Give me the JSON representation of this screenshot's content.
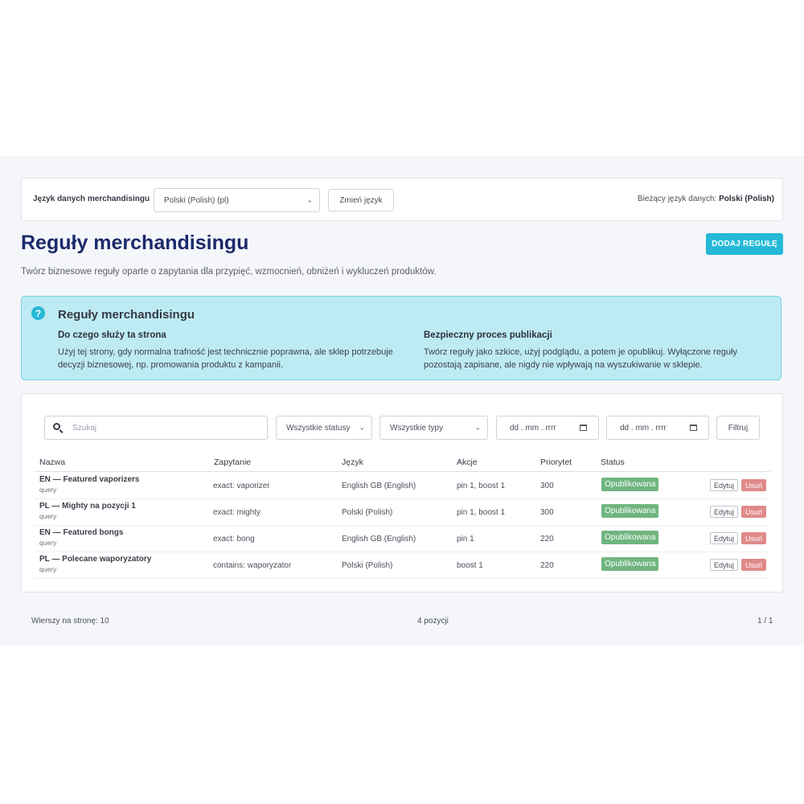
{
  "language_bar": {
    "label": "Język danych merchandisingu",
    "selected_language": "Polski (Polish) (pl)",
    "change_button": "Zmień język",
    "current_prefix": "Bieżący język danych:",
    "current_value": "Polski (Polish)"
  },
  "page": {
    "title": "Reguły merchandisingu",
    "add_button": "DODAJ REGUŁĘ",
    "subtitle": "Twórz biznesowe reguły oparte o zapytania dla przypięć, wzmocnień, obniżeń i wykluczeń produktów."
  },
  "info": {
    "title": "Reguły merchandisingu",
    "col1_heading": "Do czego służy ta strona",
    "col1_text": "Użyj tej strony, gdy normalna trafność jest technicznie poprawna, ale sklep potrzebuje decyzji biznesowej, np. promowania produktu z kampanii.",
    "col2_heading": "Bezpieczny proces publikacji",
    "col2_text": "Twórz reguły jako szkice, użyj podglądu, a potem je opublikuj. Wyłączone reguły pozostają zapisane, ale nigdy nie wpływają na wyszukiwanie w sklepie."
  },
  "filters": {
    "search_placeholder": "Szukaj",
    "status_select": "Wszystkie statusy",
    "type_select": "Wszystkie typy",
    "date_from_placeholder": "dd . mm . rrrr",
    "date_to_placeholder": "dd . mm . rrrr",
    "filter_button": "Filtruj"
  },
  "table": {
    "headers": [
      "Nazwa",
      "Zapytanie",
      "Język",
      "Akcje",
      "Priorytet",
      "Status"
    ],
    "edit_label": "Edytuj",
    "delete_label": "Usuń",
    "rows": [
      {
        "name": "EN — Featured vaporizers",
        "sub": "query",
        "query": "exact: vaporizer",
        "language": "English GB (English)",
        "actions": "pin 1, boost 1",
        "priority": "300",
        "status": "Opublikowana"
      },
      {
        "name": "PL — Mighty na pozycji 1",
        "sub": "query",
        "query": "exact: mighty",
        "language": "Polski (Polish)",
        "actions": "pin 1, boost 1",
        "priority": "300",
        "status": "Opublikowana"
      },
      {
        "name": "EN — Featured bongs",
        "sub": "query",
        "query": "exact: bong",
        "language": "English GB (English)",
        "actions": "pin 1",
        "priority": "220",
        "status": "Opublikowana"
      },
      {
        "name": "PL — Polecane waporyzatory",
        "sub": "query",
        "query": "contains: waporyzator",
        "language": "Polski (Polish)",
        "actions": "boost 1",
        "priority": "220",
        "status": "Opublikowana"
      }
    ]
  },
  "footer": {
    "rows_per_page": "Wierszy na stronę: 10",
    "count": "4 pozycji",
    "pages": "1 / 1"
  },
  "colors": {
    "accent": "#25b9d7",
    "title": "#1c2a6b",
    "info_bg": "#beebf3",
    "status_published": "#70b580",
    "delete": "#e08a8a"
  }
}
